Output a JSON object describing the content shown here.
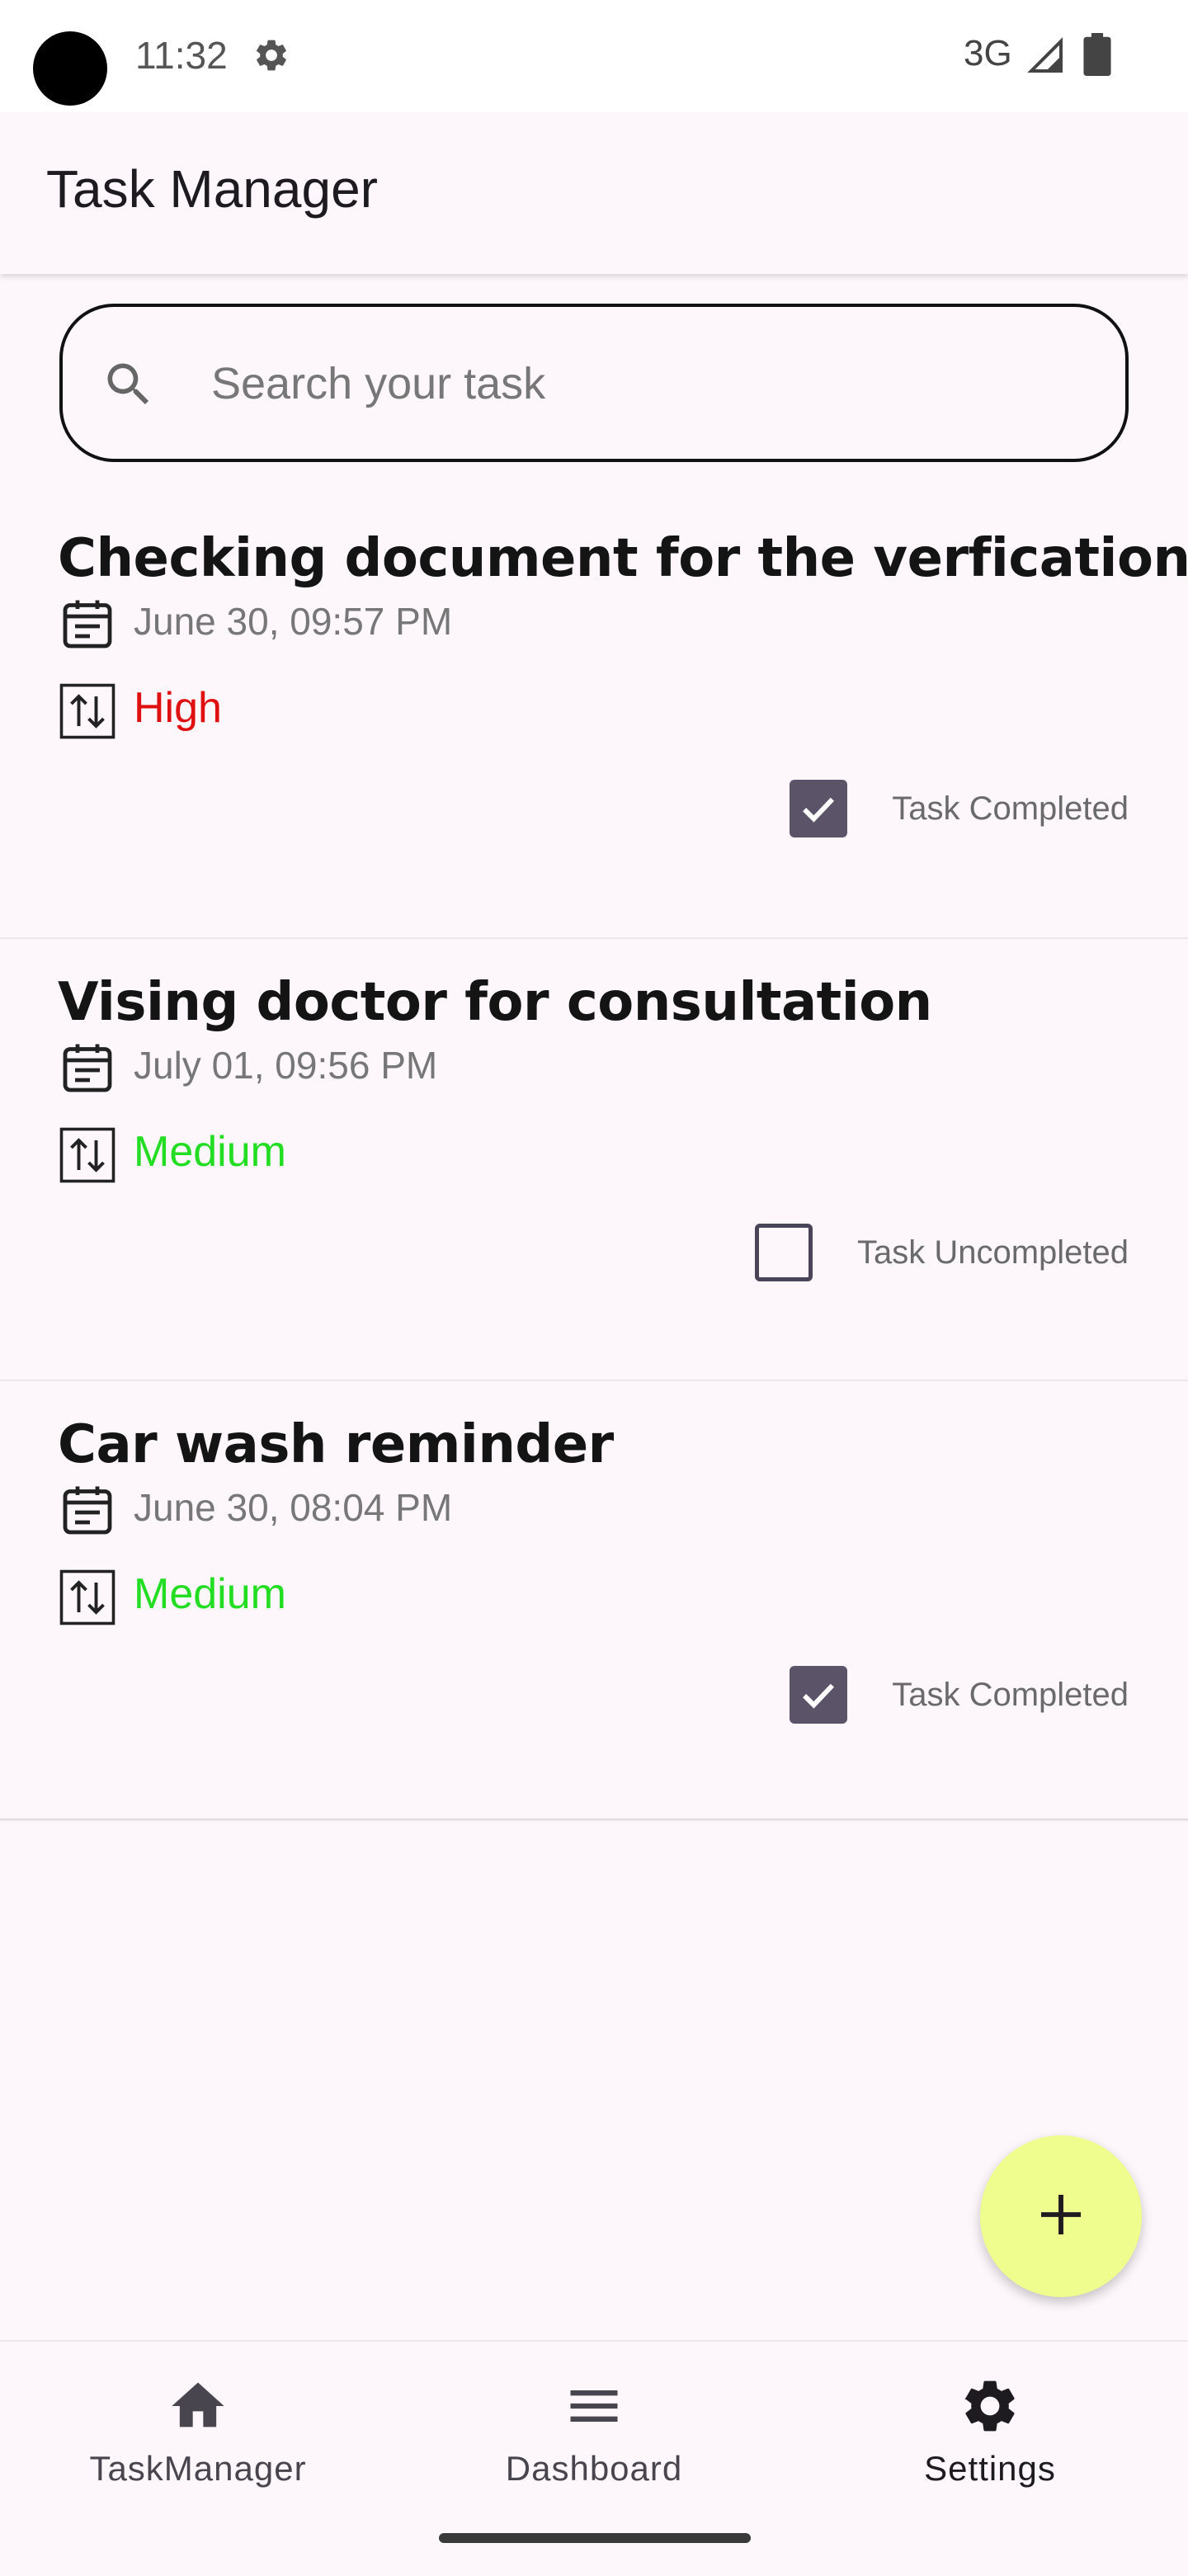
{
  "status_bar": {
    "time": "11:32",
    "network": "3G",
    "icons": [
      "gear-icon",
      "signal-icon",
      "battery-icon"
    ]
  },
  "app_bar": {
    "title": "Task Manager"
  },
  "search": {
    "placeholder": "Search your task",
    "value": ""
  },
  "tasks": [
    {
      "title": "Checking document for the verfication",
      "date": "June 30, 09:57 PM",
      "priority": "High",
      "priority_color": "#e01010",
      "completed": true,
      "status_label": "Task Completed"
    },
    {
      "title": "Vising doctor for consultation",
      "date": "July 01, 09:56 PM",
      "priority": "Medium",
      "priority_color": "#22dd22",
      "completed": false,
      "status_label": "Task Uncompleted"
    },
    {
      "title": "Car wash reminder",
      "date": "June 30, 08:04 PM",
      "priority": "Medium",
      "priority_color": "#22dd22",
      "completed": true,
      "status_label": "Task Completed"
    }
  ],
  "fab": {
    "icon": "plus-icon",
    "color": "#eefd8e"
  },
  "bottom_nav": {
    "items": [
      {
        "label": "TaskManager",
        "icon": "home-icon",
        "active": false
      },
      {
        "label": "Dashboard",
        "icon": "menu-icon",
        "active": false
      },
      {
        "label": "Settings",
        "icon": "gear-icon",
        "active": true
      }
    ]
  },
  "colors": {
    "background": "#fdf7fb",
    "checkbox_checked": "#5b5469",
    "fab": "#eefd8e"
  }
}
